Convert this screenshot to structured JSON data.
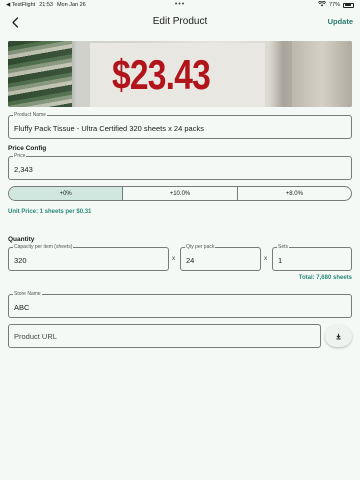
{
  "status": {
    "app": "◀ TestFlight",
    "time": "21:53",
    "date": "Mon Jan 26",
    "dots": "•••",
    "battery": "77%"
  },
  "nav": {
    "title": "Edit Product",
    "update_label": "Update",
    "back_icon": "chevron-left-icon"
  },
  "image": {
    "price_text": "$23.43"
  },
  "product_name": {
    "label": "Product Name",
    "value": "Fluffy Pack Tissue - Ultra Certified 320 sheets x 24 packs"
  },
  "price_config": {
    "title": "Price Config",
    "price_label": "Price",
    "price_value": "2,343",
    "adjustments": [
      "+0%",
      "+10.0%",
      "+8.0%"
    ],
    "selected_index": 0,
    "unit_price": "Unit Price: 1 sheets per $0.31"
  },
  "quantity": {
    "title": "Quantity",
    "capacity_label": "Capacity per item (sheets)",
    "capacity_value": "320",
    "times_symbol": "x",
    "qty_label": "Qty per pack",
    "qty_value": "24",
    "sets_label": "Sets",
    "sets_value": "1",
    "total": "Total: 7,680 sheets"
  },
  "store": {
    "label": "Store Name",
    "value": "ABC"
  },
  "product_url": {
    "placeholder": "Product URL",
    "download_icon": "download-icon"
  },
  "colors": {
    "accent": "#2a8a78",
    "background": "#f5f9f6",
    "segment_active": "#cfe7df",
    "price_red": "#b2141b"
  }
}
